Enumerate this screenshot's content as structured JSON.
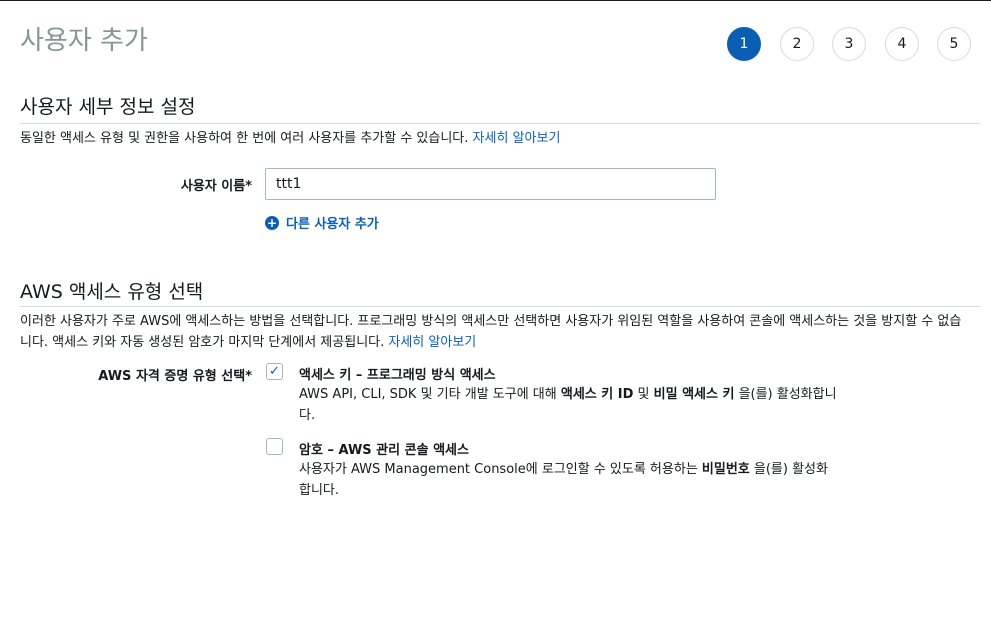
{
  "header": {
    "title": "사용자 추가",
    "steps": [
      "1",
      "2",
      "3",
      "4",
      "5"
    ],
    "active_step": "1"
  },
  "details_section": {
    "title": "사용자 세부 정보 설정",
    "description": "동일한 액세스 유형 및 권한을 사용하여 한 번에 여러 사용자를 추가할 수 있습니다.",
    "learn_more": "자세히 알아보기",
    "username_label": "사용자 이름*",
    "username_value": "ttt1",
    "add_user_label": "다른 사용자 추가"
  },
  "access_section": {
    "title": "AWS 액세스 유형 선택",
    "description_line1": "이러한 사용자가 주로 AWS에 액세스하는 방법을 선택합니다. 프로그래밍 방식의 액세스만 선택하면 사용자가 위임된 역할을 사용하여 콘솔에 액세스하는 것을 방지할 수 없습",
    "description_line2": "니다. 액세스 키와 자동 생성된 암호가 마지막 단계에서 제공됩니다.",
    "learn_more": "자세히 알아보기",
    "credential_label": "AWS 자격 증명 유형 선택*",
    "options": [
      {
        "checked": true,
        "title": "액세스 키 – 프로그래밍 방식 액세스",
        "desc_pre": "AWS API, CLI, SDK 및 기타 개발 도구에 대해 ",
        "desc_bold1": "액세스 키 ID",
        "desc_mid": " 및 ",
        "desc_bold2": "비밀 액세스 키",
        "desc_post": " 을(를) 활성화합니다."
      },
      {
        "checked": false,
        "title": "암호 – AWS 관리 콘솔 액세스",
        "desc_pre": "사용자가 AWS Management Console에 로그인할 수 있도록 허용하는 ",
        "desc_bold1": "비밀번호",
        "desc_post": " 을(를) 활성화합니다."
      }
    ]
  },
  "colors": {
    "accent": "#0a5fb4",
    "title_gray": "#879596",
    "border": "#d5dbdb"
  }
}
